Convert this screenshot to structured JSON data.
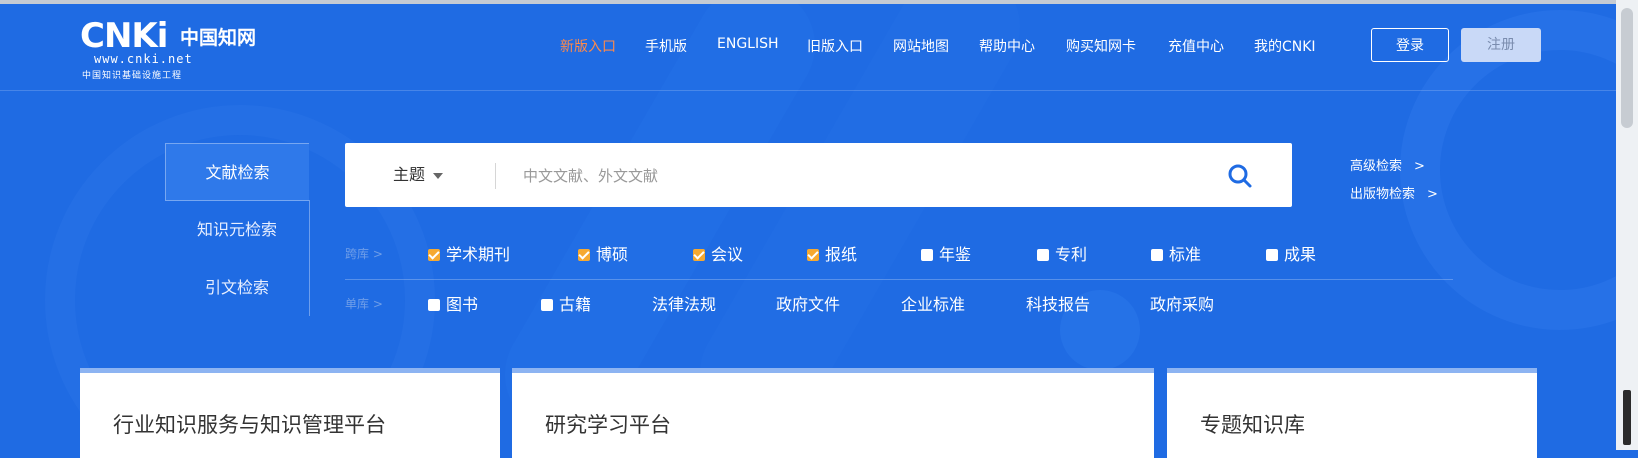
{
  "header": {
    "logo": {
      "brand": "CNKi",
      "brand_cn": "中国知网",
      "url": "www.cnki.net",
      "slogan": "中国知识基础设施工程"
    },
    "nav": [
      {
        "label": "新版入口",
        "highlight": true
      },
      {
        "label": "手机版"
      },
      {
        "label": "ENGLISH"
      },
      {
        "label": "旧版入口"
      },
      {
        "label": "网站地图"
      },
      {
        "label": "帮助中心"
      },
      {
        "label": "购买知网卡"
      },
      {
        "label": "充值中心"
      },
      {
        "label": "我的CNKI"
      }
    ],
    "login_label": "登录",
    "register_label": "注册"
  },
  "tabs": [
    {
      "label": "文献检索",
      "active": true
    },
    {
      "label": "知识元检索"
    },
    {
      "label": "引文检索"
    }
  ],
  "search": {
    "field_select": "主题",
    "placeholder": "中文文献、外文文献",
    "value": ""
  },
  "advanced": [
    {
      "label": "高级检索",
      "arrow": ">"
    },
    {
      "label": "出版物检索",
      "arrow": ">"
    }
  ],
  "cross_db": {
    "label": "跨库 >",
    "options": [
      {
        "label": "学术期刊",
        "checked": true
      },
      {
        "label": "博硕",
        "checked": true
      },
      {
        "label": "会议",
        "checked": true
      },
      {
        "label": "报纸",
        "checked": true
      },
      {
        "label": "年鉴",
        "checked": false
      },
      {
        "label": "专利",
        "checked": false
      },
      {
        "label": "标准",
        "checked": false
      },
      {
        "label": "成果",
        "checked": false
      }
    ]
  },
  "single_db": {
    "label": "单库 >",
    "options": [
      {
        "label": "图书",
        "checkbox": true
      },
      {
        "label": "古籍",
        "checkbox": true
      },
      {
        "label": "法律法规"
      },
      {
        "label": "政府文件"
      },
      {
        "label": "企业标准"
      },
      {
        "label": "科技报告"
      },
      {
        "label": "政府采购"
      }
    ]
  },
  "cards": [
    {
      "title": "行业知识服务与知识管理平台"
    },
    {
      "title": "研究学习平台"
    },
    {
      "title": "专题知识库"
    }
  ],
  "colors": {
    "background": "#1f6be3",
    "highlight_nav": "#ff8a4a",
    "checkbox_checked": "#f6a931",
    "search_icon": "#1f6be3"
  }
}
